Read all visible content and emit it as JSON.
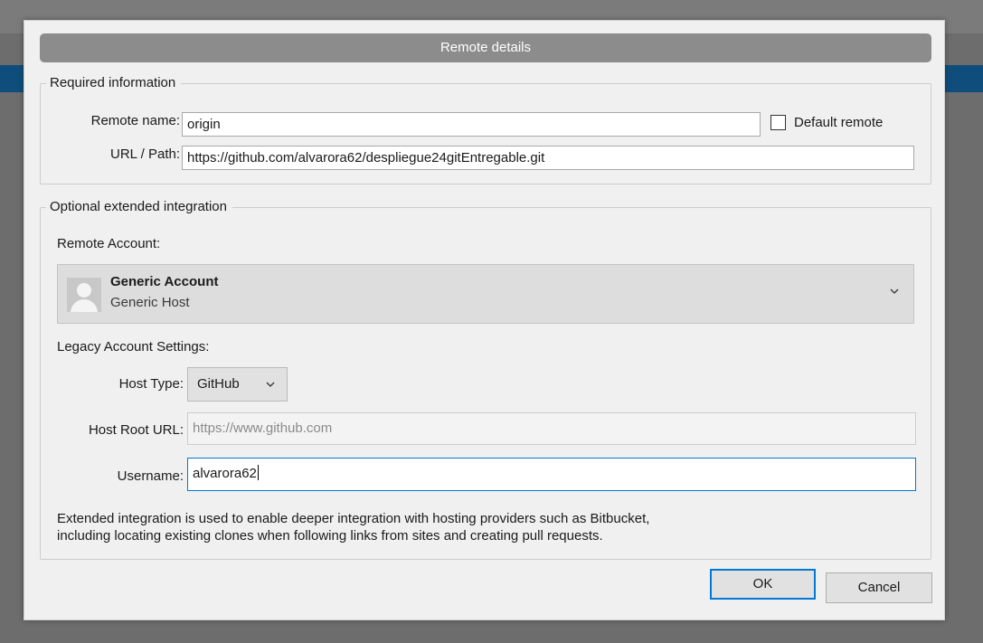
{
  "dialog": {
    "title": "Remote details"
  },
  "required": {
    "legend": "Required information",
    "remote_name_label": "Remote name:",
    "remote_name_value": "origin",
    "default_remote_label": "Default remote",
    "default_remote_checked": false,
    "url_label": "URL / Path:",
    "url_value": "https://github.com/alvarora62/despliegue24gitEntregable.git"
  },
  "optional": {
    "legend": "Optional extended integration",
    "remote_account_label": "Remote Account:",
    "account": {
      "name": "Generic Account",
      "host": "Generic Host",
      "avatar_icon": "user-avatar-icon",
      "dropdown_icon": "chevron-down-icon"
    },
    "legacy_label": "Legacy Account Settings:",
    "host_type_label": "Host Type:",
    "host_type_value": "GitHub",
    "host_root_label": "Host Root URL:",
    "host_root_value": "https://www.github.com",
    "username_label": "Username:",
    "username_value": "alvarora62",
    "description_line1": "Extended integration is used to enable deeper integration with hosting providers such as Bitbucket,",
    "description_line2": "including locating existing clones when following links from sites and creating pull requests."
  },
  "buttons": {
    "ok": "OK",
    "cancel": "Cancel"
  },
  "colors": {
    "focus_border": "#0078d7",
    "titlebar": "#8c8c8c",
    "background_accent": "#0f4e7c"
  }
}
